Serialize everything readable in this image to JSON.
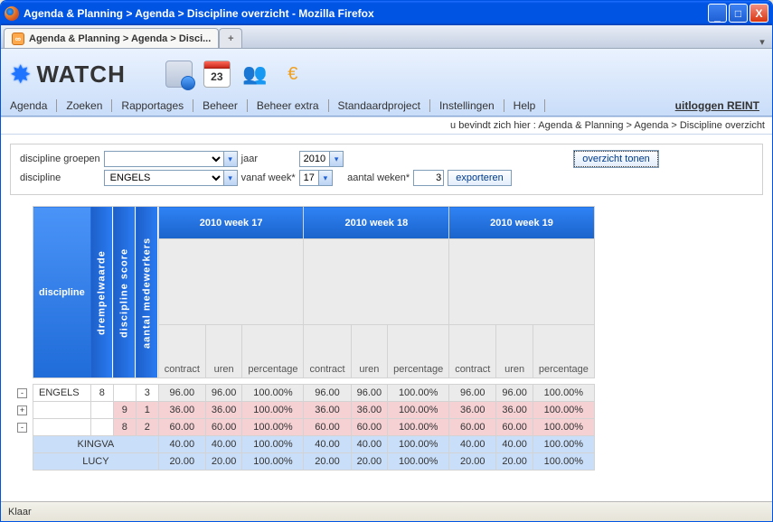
{
  "window_title": "Agenda & Planning > Agenda > Discipline overzicht - Mozilla Firefox",
  "tab_title": "Agenda & Planning > Agenda > Disci...",
  "app_name": "WATCH",
  "calendar_badge": "23",
  "menu": [
    "Agenda",
    "Zoeken",
    "Rapportages",
    "Beheer",
    "Beheer extra",
    "Standaardproject",
    "Instellingen",
    "Help"
  ],
  "logout": "uitloggen REINT",
  "breadcrumb_prefix": "u bevindt zich hier : ",
  "breadcrumb": "Agenda & Planning > Agenda > Discipline overzicht",
  "filters": {
    "discipline_groepen_label": "discipline groepen",
    "discipline_groepen_value": "",
    "jaar_label": "jaar",
    "jaar_value": "2010",
    "overzicht_tonen": "overzicht tonen",
    "discipline_label": "discipline",
    "discipline_value": "ENGELS",
    "vanaf_week_label": "vanaf week*",
    "vanaf_week_value": "17",
    "aantal_weken_label": "aantal weken*",
    "aantal_weken_value": "3",
    "exporteren": "exporteren"
  },
  "grid": {
    "side_header": "discipline",
    "col_drempel": "drempelwaarde",
    "col_score": "discipline score",
    "col_medew": "aantal medewerkers",
    "weeks": [
      "2010 week 17",
      "2010 week 18",
      "2010 week 19"
    ],
    "sub": {
      "contract": "contract",
      "uren": "uren",
      "percentage": "percentage"
    },
    "rows": [
      {
        "toggle": "-",
        "label": "ENGELS",
        "drempel": "8",
        "score": "",
        "medew": "3",
        "style": "gray",
        "cells": [
          "96.00",
          "96.00",
          "100.00%",
          "96.00",
          "96.00",
          "100.00%",
          "96.00",
          "96.00",
          "100.00%"
        ]
      },
      {
        "toggle": "+",
        "label": "",
        "drempel": "",
        "score": "9",
        "medew": "1",
        "style": "pink",
        "cells": [
          "36.00",
          "36.00",
          "100.00%",
          "36.00",
          "36.00",
          "100.00%",
          "36.00",
          "36.00",
          "100.00%"
        ]
      },
      {
        "toggle": "-",
        "label": "",
        "drempel": "",
        "score": "8",
        "medew": "2",
        "style": "pink",
        "cells": [
          "60.00",
          "60.00",
          "100.00%",
          "60.00",
          "60.00",
          "100.00%",
          "60.00",
          "60.00",
          "100.00%"
        ]
      },
      {
        "toggle": "",
        "label": "KINGVA",
        "drempel": "",
        "score": "",
        "medew": "",
        "style": "blue",
        "labelcell": true,
        "cells": [
          "40.00",
          "40.00",
          "100.00%",
          "40.00",
          "40.00",
          "100.00%",
          "40.00",
          "40.00",
          "100.00%"
        ]
      },
      {
        "toggle": "",
        "label": "LUCY",
        "drempel": "",
        "score": "",
        "medew": "",
        "style": "blue",
        "labelcell": true,
        "cells": [
          "20.00",
          "20.00",
          "100.00%",
          "20.00",
          "20.00",
          "100.00%",
          "20.00",
          "20.00",
          "100.00%"
        ]
      }
    ]
  },
  "status": "Klaar"
}
